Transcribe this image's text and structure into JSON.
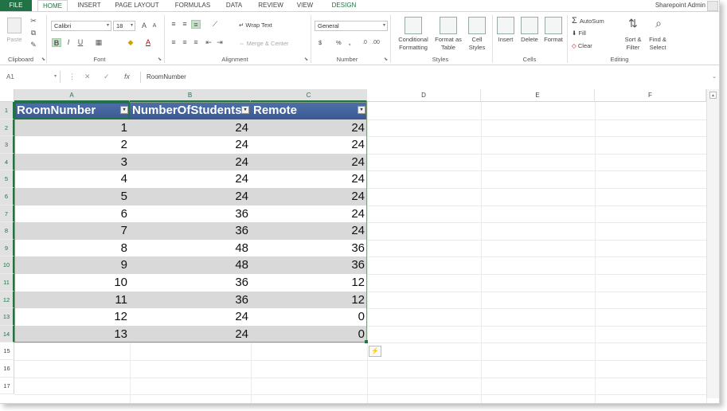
{
  "tabs": [
    {
      "id": "file",
      "label": "FILE"
    },
    {
      "id": "home",
      "label": "HOME"
    },
    {
      "id": "insert",
      "label": "INSERT"
    },
    {
      "id": "page_layout",
      "label": "PAGE LAYOUT"
    },
    {
      "id": "formulas",
      "label": "FORMULAS"
    },
    {
      "id": "data",
      "label": "DATA"
    },
    {
      "id": "review",
      "label": "REVIEW"
    },
    {
      "id": "view",
      "label": "VIEW"
    },
    {
      "id": "design",
      "label": "DESIGN"
    }
  ],
  "account": {
    "name": "Sharepoint Admin"
  },
  "ribbon": {
    "clipboard": {
      "label": "Clipboard",
      "paste": "Paste"
    },
    "font": {
      "label": "Font",
      "family": "Calibri",
      "size": "18"
    },
    "alignment": {
      "label": "Alignment",
      "wrap_text": "Wrap Text",
      "merge_center": "Merge & Center"
    },
    "number": {
      "label": "Number",
      "format": "General",
      "currency": "$",
      "percent": "%",
      "comma": ","
    },
    "styles": {
      "label": "Styles",
      "conditional_1": "Conditional",
      "conditional_2": "Formatting",
      "format_as_1": "Format as",
      "format_as_2": "Table",
      "cell_1": "Cell",
      "cell_2": "Styles"
    },
    "cells": {
      "label": "Cells",
      "insert": "Insert",
      "delete": "Delete",
      "format": "Format"
    },
    "editing": {
      "label": "Editing",
      "autosum": "AutoSum",
      "fill": "Fill",
      "clear": "Clear",
      "sort_1": "Sort &",
      "sort_2": "Filter",
      "find_1": "Find &",
      "find_2": "Select"
    }
  },
  "formula_bar": {
    "name_box": "A1",
    "fx": "fx",
    "content": "RoomNumber"
  },
  "columns": [
    "A",
    "B",
    "C",
    "D",
    "E",
    "F"
  ],
  "rows": [
    "1",
    "2",
    "3",
    "4",
    "5",
    "6",
    "7",
    "8",
    "9",
    "10",
    "11",
    "12",
    "13",
    "14",
    "15",
    "16",
    "17"
  ],
  "table": {
    "headers": [
      "RoomNumber",
      "NumberOfStudents",
      "Remote"
    ],
    "rows": [
      [
        1,
        24,
        24
      ],
      [
        2,
        24,
        24
      ],
      [
        3,
        24,
        24
      ],
      [
        4,
        24,
        24
      ],
      [
        5,
        24,
        24
      ],
      [
        6,
        36,
        24
      ],
      [
        7,
        36,
        24
      ],
      [
        8,
        48,
        36
      ],
      [
        9,
        48,
        36
      ],
      [
        10,
        36,
        12
      ],
      [
        11,
        36,
        12
      ],
      [
        12,
        24,
        0
      ],
      [
        13,
        24,
        0
      ]
    ]
  },
  "colors": {
    "accent": "#217346",
    "table_header": "#3b5a93",
    "band": "#d9d9d9"
  }
}
